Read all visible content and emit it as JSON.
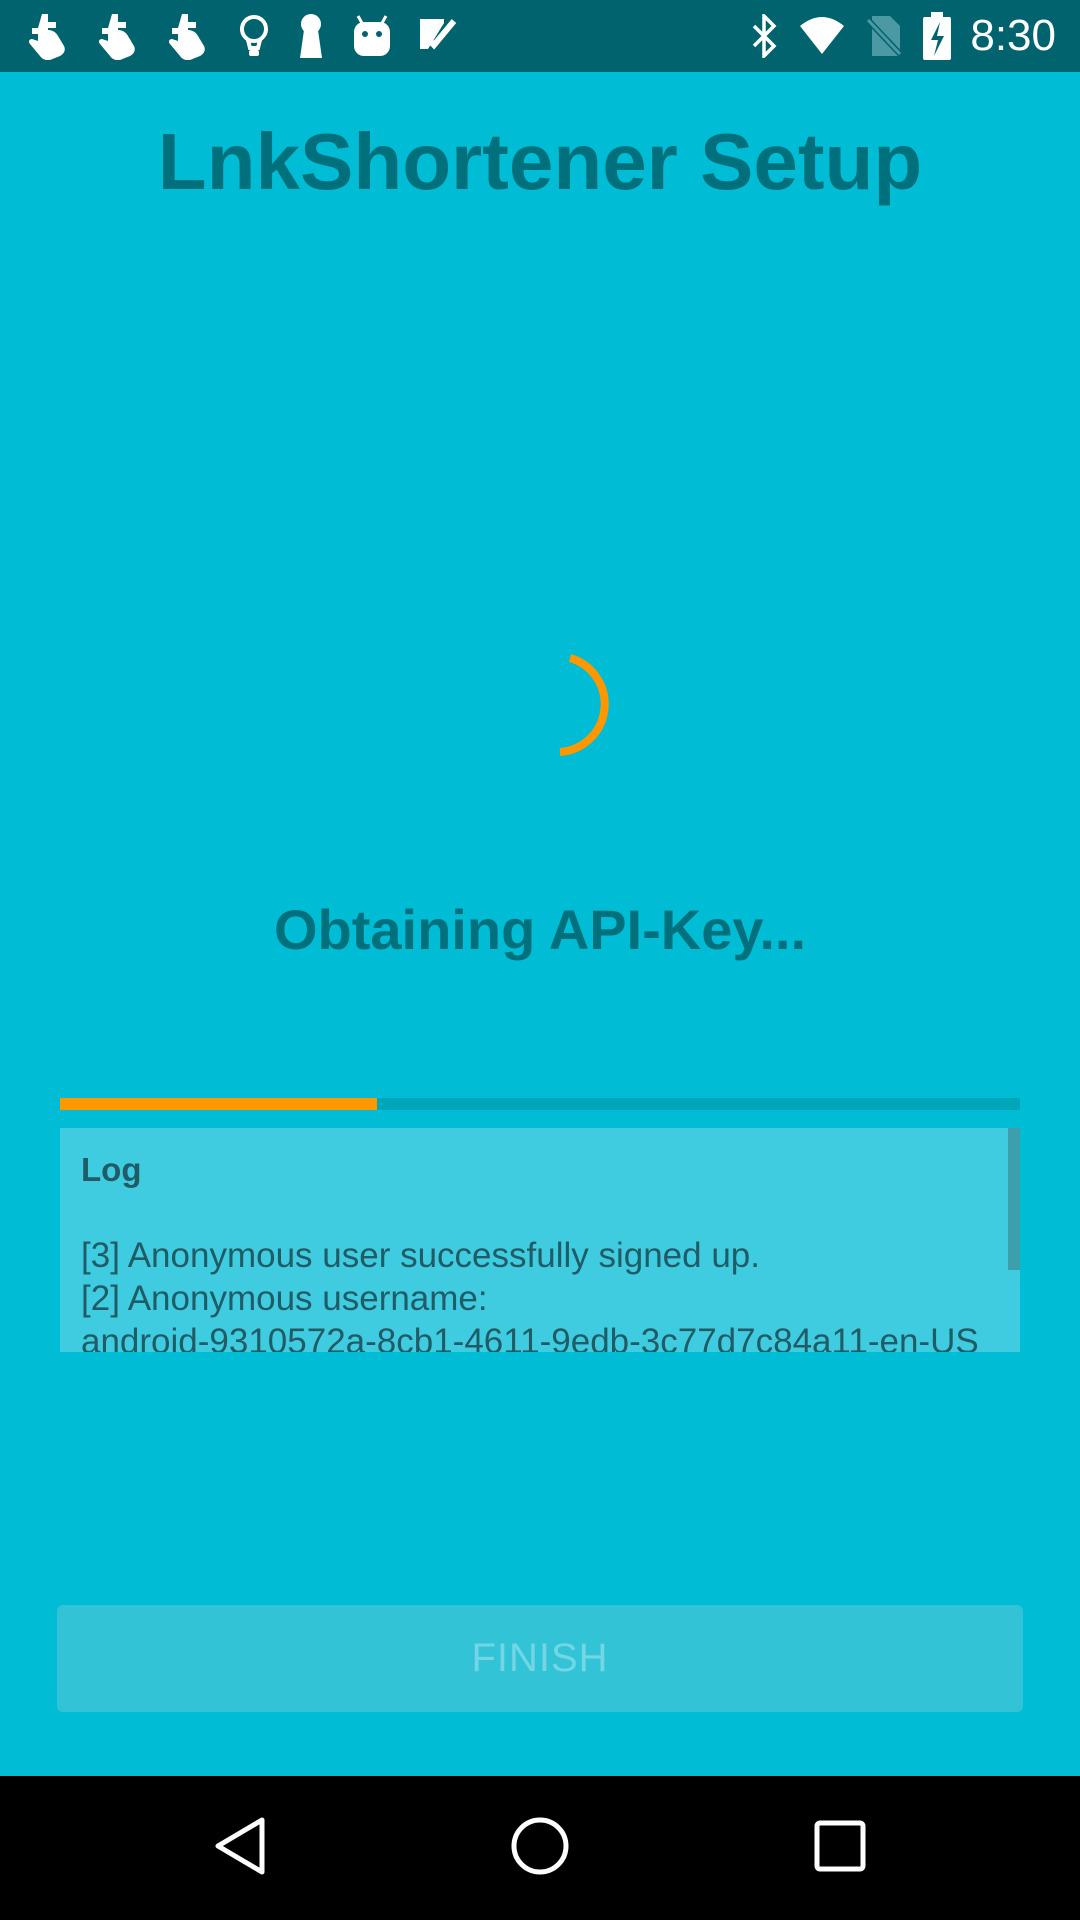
{
  "status_bar": {
    "time": "8:30",
    "left_icons": [
      "gesture-icon",
      "gesture-icon",
      "gesture-icon",
      "lightbulb-icon",
      "keyhole-icon",
      "android-icon",
      "checklist-icon"
    ],
    "right_icons": [
      "bluetooth-icon",
      "wifi-icon",
      "no-sim-icon",
      "battery-charging-icon"
    ]
  },
  "page": {
    "title": "LnkShortener Setup",
    "status_text": "Obtaining API-Key..."
  },
  "progress": {
    "fraction": 0.33,
    "fill_color": "#FF9800"
  },
  "log": {
    "title": "Log",
    "lines": [
      "[3] Anonymous user successfully signed up.",
      "[2] Anonymous username:",
      "android-9310572a-8cb1-4611-9edb-3c77d7c84a11-en-US"
    ]
  },
  "finish_button": {
    "label": "FINISH",
    "enabled": false
  },
  "nav_bar": {
    "buttons": [
      "back",
      "home",
      "recents"
    ]
  },
  "colors": {
    "background": "#00BCD4",
    "status_bar": "#00636E",
    "accent": "#FF9800",
    "text": "#00707C"
  }
}
